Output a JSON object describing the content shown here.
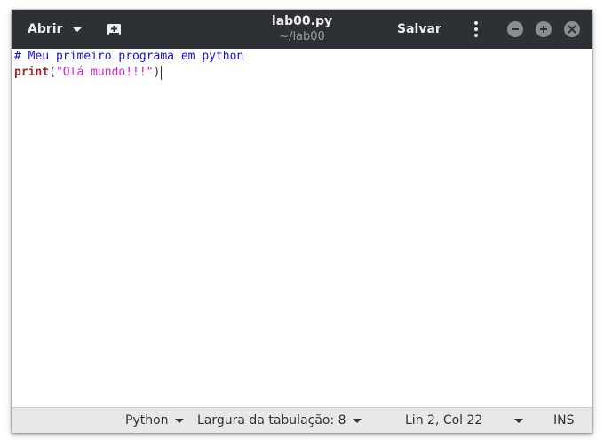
{
  "header": {
    "open_label": "Abrir",
    "title": "lab00.py",
    "subtitle": "~/lab00",
    "save_label": "Salvar",
    "icons": {
      "open_dropdown": "chevron-down-icon",
      "new_document": "new-document-icon",
      "menu": "kebab-menu-icon",
      "minimize": "minimize-icon",
      "maximize": "maximize-icon",
      "close": "close-icon"
    }
  },
  "editor": {
    "lines": [
      {
        "comment": "# Meu primeiro programa em python"
      },
      {
        "keyword": "print",
        "open_paren": "(",
        "string": "\"Olá mundo!!!\"",
        "close_paren": ")"
      }
    ],
    "colors": {
      "comment": "#1c0fcf",
      "keyword": "#a52a2a",
      "string": "#d41fd0"
    }
  },
  "statusbar": {
    "language": "Python",
    "tab_width": "Largura da tabulação: 8",
    "position": "Lin 2, Col 22",
    "mode": "INS"
  },
  "theme": {
    "titlebar_bg": "#2d3135",
    "statusbar_bg": "#e8e8e7"
  }
}
